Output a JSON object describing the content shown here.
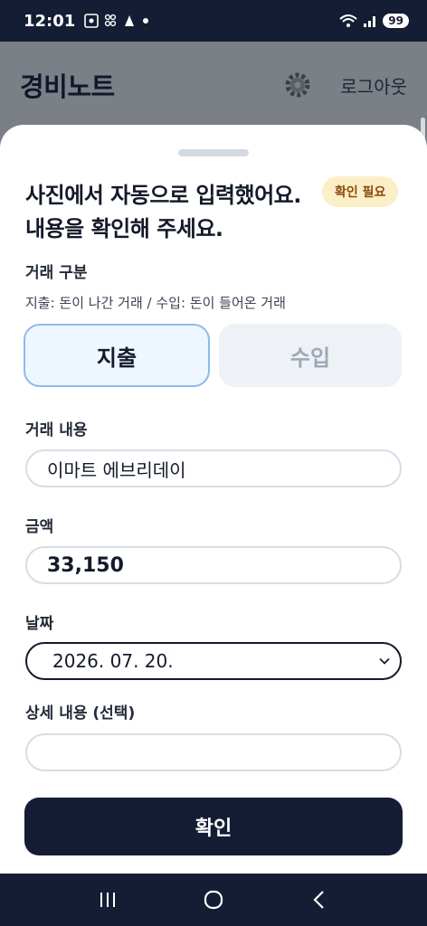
{
  "status": {
    "time": "12:01",
    "battery": "99"
  },
  "header": {
    "title": "경비노트",
    "logout_label": "로그아웃"
  },
  "sheet": {
    "title": "사진에서 자동으로 입력했어요. 내용을 확인해 주세요.",
    "badge": "확인 필요",
    "type_section": {
      "label": "거래 구분",
      "hint": "지출: 돈이 나간 거래 / 수입: 돈이 들어온 거래",
      "options": [
        "지출",
        "수입"
      ],
      "selected": "지출"
    },
    "description": {
      "label": "거래 내용",
      "value": "이마트 에브리데이"
    },
    "amount": {
      "label": "금액",
      "value": "33,150"
    },
    "date": {
      "label": "날짜",
      "value": "2026. 07. 20."
    },
    "detail": {
      "label": "상세 내용 (선택)",
      "value": ""
    },
    "confirm_label": "확인"
  },
  "icons": [
    "gear-icon",
    "wifi-icon",
    "signal-icon",
    "battery-icon",
    "chevron-down-icon",
    "recents-icon",
    "home-icon",
    "back-icon"
  ],
  "colors": {
    "primary": "#141d33",
    "accent_border": "#8fb9eb",
    "badge_bg": "#fcefc7",
    "badge_text": "#8a4a0c"
  }
}
